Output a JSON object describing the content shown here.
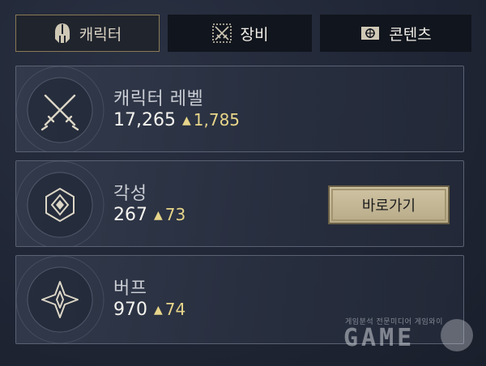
{
  "tabs": [
    {
      "label": "캐릭터",
      "icon": "helmet-icon",
      "active": true
    },
    {
      "label": "장비",
      "icon": "crossed-swords-icon",
      "active": false
    },
    {
      "label": "콘텐츠",
      "icon": "scroll-map-icon",
      "active": false
    }
  ],
  "cards": [
    {
      "title": "캐릭터 레벨",
      "value": "17,265",
      "delta": "1,785",
      "icon": "crossed-swords-icon"
    },
    {
      "title": "각성",
      "value": "267",
      "delta": "73",
      "icon": "awakening-crystal-icon",
      "button": "바로가기"
    },
    {
      "title": "버프",
      "value": "970",
      "delta": "74",
      "icon": "buff-star-icon"
    }
  ],
  "watermark": {
    "caption": "게임분석 전문미디어 게임와이",
    "logo": "GAME"
  },
  "colors": {
    "accent_gold": "#e7d58a",
    "button_bg": "#c4b795",
    "active_tab_border": "#8a7a55"
  }
}
